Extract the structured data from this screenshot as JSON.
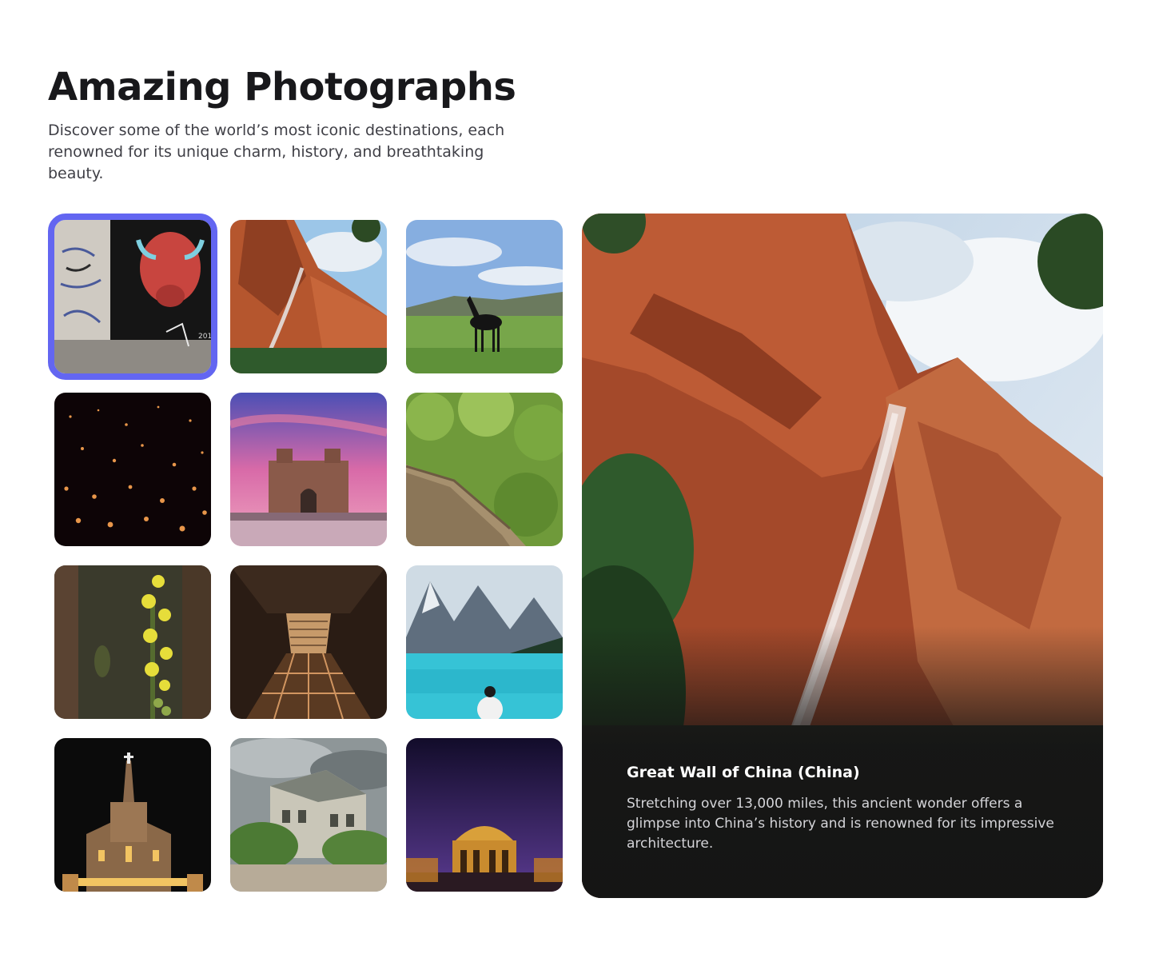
{
  "header": {
    "title": "Amazing Photographs",
    "subtitle": "Discover some of the world’s most iconic destinations, each renowned for its unique charm, history, and breathtaking beauty."
  },
  "colors": {
    "selection_accent": "#6366f1"
  },
  "selected_index": 0,
  "thumbnails": [
    {
      "subject": "graffiti-bull-mural"
    },
    {
      "subject": "red-cliff-waterfall"
    },
    {
      "subject": "black-horse-meadow"
    },
    {
      "subject": "floating-lanterns-night"
    },
    {
      "subject": "gateway-arch-sunset"
    },
    {
      "subject": "great-wall-forest"
    },
    {
      "subject": "yellow-flowers"
    },
    {
      "subject": "underground-staircase"
    },
    {
      "subject": "mountain-lake"
    },
    {
      "subject": "church-night"
    },
    {
      "subject": "abandoned-villa"
    },
    {
      "subject": "domed-palace-night"
    }
  ],
  "feature": {
    "title": "Great Wall of China (China)",
    "description": "Stretching over 13,000 miles, this ancient wonder offers a glimpse into China’s history and is renowned for its impressive architecture."
  }
}
